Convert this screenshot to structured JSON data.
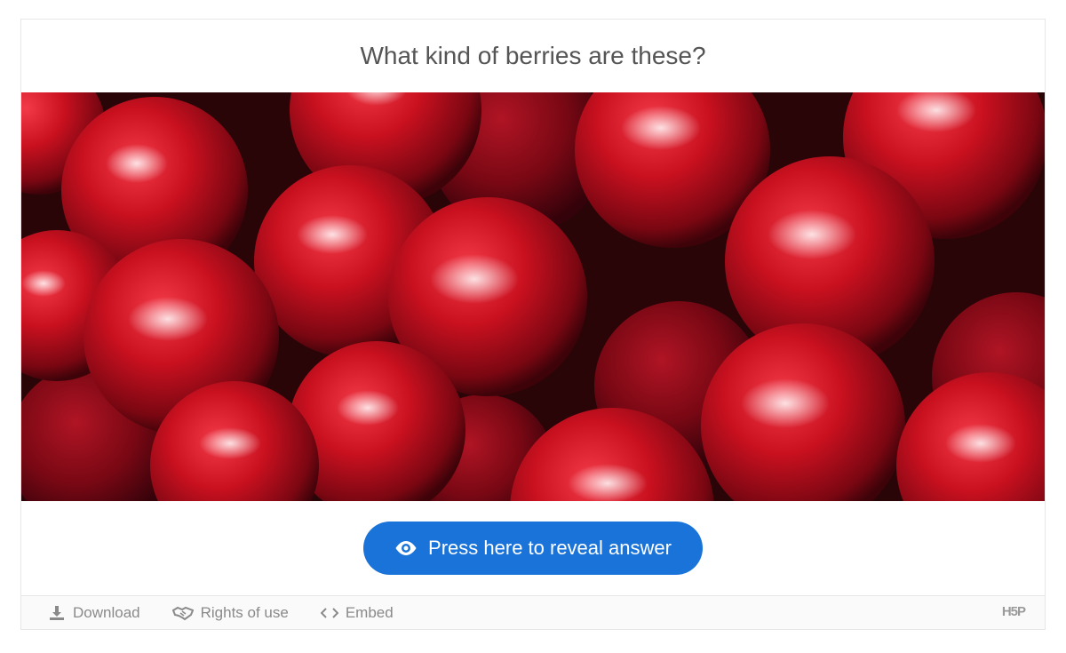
{
  "question": "What kind of berries are these?",
  "image": {
    "subject": "red cherries"
  },
  "reveal_button": {
    "label": "Press here to reveal answer",
    "icon": "eye-icon"
  },
  "footer": {
    "download": "Download",
    "rights": "Rights of use",
    "embed": "Embed",
    "logo": "H5P"
  },
  "colors": {
    "button": "#1a73d9",
    "footer_text": "#8a8a8a",
    "question_text": "#555555"
  }
}
